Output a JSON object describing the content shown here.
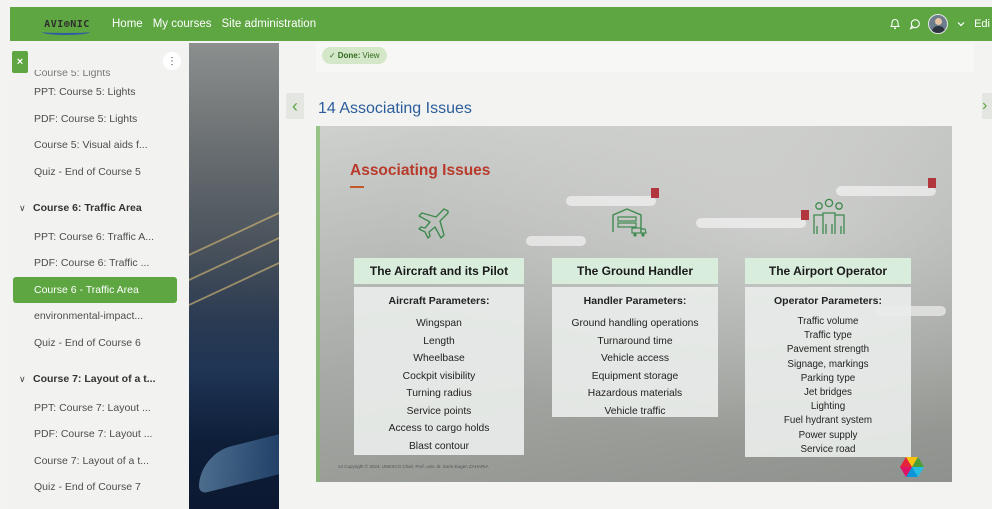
{
  "navbar": {
    "logo_text": "AVI⊕NIC",
    "links": [
      "Home",
      "My courses",
      "Site administration"
    ],
    "edit_label": "Edi"
  },
  "drawer": {
    "close_label": "×",
    "menu_label": "⋮",
    "items": [
      {
        "kind": "cut",
        "label": "Course 5: Lights"
      },
      {
        "kind": "item",
        "label": "PPT: Course 5: Lights"
      },
      {
        "kind": "item",
        "label": "PDF: Course 5: Lights"
      },
      {
        "kind": "item",
        "label": "Course 5: Visual aids f..."
      },
      {
        "kind": "item",
        "label": "Quiz - End of Course 5"
      },
      {
        "kind": "section",
        "label": "Course 6: Traffic Area"
      },
      {
        "kind": "item",
        "label": "PPT: Course 6: Traffic A..."
      },
      {
        "kind": "item",
        "label": "PDF: Course 6: Traffic ..."
      },
      {
        "kind": "active",
        "label": "Course 6 - Traffic Area"
      },
      {
        "kind": "item",
        "label": "environmental-impact..."
      },
      {
        "kind": "item",
        "label": "Quiz - End of Course 6"
      },
      {
        "kind": "section",
        "label": "Course 7: Layout of a t..."
      },
      {
        "kind": "item",
        "label": "PPT: Course 7: Layout ..."
      },
      {
        "kind": "item",
        "label": "PDF: Course 7: Layout ..."
      },
      {
        "kind": "item",
        "label": "Course 7: Layout of a t..."
      },
      {
        "kind": "item",
        "label": "Quiz - End of Course 7"
      }
    ]
  },
  "completion": {
    "done_label": "Done:",
    "done_value": "View"
  },
  "navigation": {
    "prev_label": "‹",
    "next_label": "›"
  },
  "page": {
    "title": "14 Associating Issues"
  },
  "slide": {
    "title": "Associating Issues",
    "columns": [
      {
        "heading": "The Aircraft and its Pilot",
        "subheading": "Aircraft Parameters:",
        "items": [
          "Wingspan",
          "Length",
          "Wheelbase",
          "Cockpit visibility",
          "Turning radius",
          "Service points",
          "Access to cargo holds",
          "Blast contour"
        ]
      },
      {
        "heading": "The Ground Handler",
        "subheading": "Handler Parameters:",
        "items": [
          "Ground handling operations",
          "Turnaround time",
          "Vehicle access",
          "Equipment storage",
          "Hazardous materials",
          "Vehicle traffic"
        ]
      },
      {
        "heading": "The Airport Operator",
        "subheading": "Operator Parameters:",
        "items": [
          "Traffic volume",
          "Traffic type",
          "Pavement strength",
          "Signage, markings",
          "Parking type",
          "Jet bridges",
          "Lighting",
          "Fuel hydrant system",
          "Power supply",
          "Service road"
        ]
      }
    ],
    "copyright": "14   Copyright © 2024, UNESCO Chair, Prof. univ. dr. Sorin-Eugen ZAHARIA"
  },
  "colors": {
    "brand_green": "#5da642",
    "title_blue": "#2c5c9b",
    "slide_title_red": "#b83a2b",
    "column_header": "#d8eddc"
  },
  "icons": {
    "notification": "bell-icon",
    "messages": "chat-icon",
    "avatar": "user-avatar",
    "col1": "airplane-icon",
    "col2": "warehouse-truck-icon",
    "col3": "people-group-icon"
  }
}
